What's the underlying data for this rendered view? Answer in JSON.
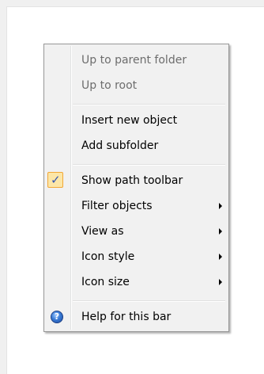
{
  "menu": {
    "items": [
      {
        "label": "Up to parent folder",
        "disabled": true
      },
      {
        "label": "Up to root",
        "disabled": true
      },
      {
        "label": "Insert new object",
        "disabled": false
      },
      {
        "label": "Add subfolder",
        "disabled": false
      },
      {
        "label": "Show path toolbar",
        "checked": true
      },
      {
        "label": "Filter objects",
        "submenu": true
      },
      {
        "label": "View as",
        "submenu": true
      },
      {
        "label": "Icon style",
        "submenu": true
      },
      {
        "label": "Icon size",
        "submenu": true
      },
      {
        "label": "Help for this bar",
        "icon": "help-icon"
      }
    ],
    "check_glyph": "✓",
    "help_glyph": "?"
  },
  "colors": {
    "menu_background": "#f1f1f1",
    "disabled_text": "#6d6d6d",
    "checked_highlight": "#fce6a7",
    "checked_border": "#f2a736",
    "help_icon_blue": "#3a7bd5"
  }
}
